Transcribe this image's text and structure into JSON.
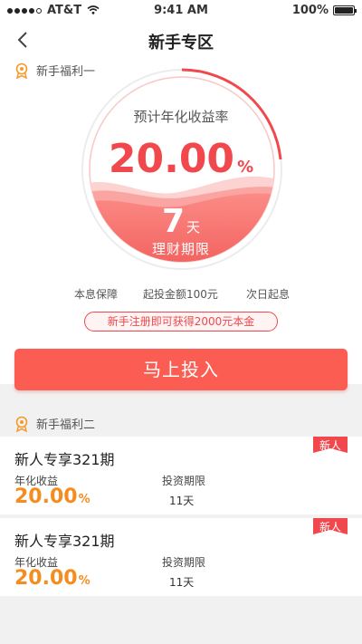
{
  "status_bar": {
    "carrier": "AT&T",
    "time": "9:41 AM",
    "battery": "100%"
  },
  "nav": {
    "title": "新手专区"
  },
  "benefit1": {
    "header": "新手福利一",
    "rate_caption": "预计年化收益率",
    "rate_value": "20.00",
    "rate_unit": "%",
    "period_value": "7",
    "period_unit": "天",
    "period_label": "理财期限",
    "features": [
      "本息保障",
      "起投金额100元",
      "次日起息"
    ],
    "promo": "新手注册即可获得2000元本金",
    "invest_button": "马上投入"
  },
  "benefit2": {
    "header": "新手福利二",
    "products": [
      {
        "title": "新人专享321期",
        "badge": "新人",
        "rate_label": "年化收益",
        "rate_value": "20.00",
        "rate_unit": "%",
        "term_label": "投资期限",
        "term_value": "11天"
      },
      {
        "title": "新人专享321期",
        "badge": "新人",
        "rate_label": "年化收益",
        "rate_value": "20.00",
        "rate_unit": "%",
        "term_label": "投资期限",
        "term_value": "11天"
      }
    ]
  },
  "colors": {
    "accent": "#f0484d",
    "button": "#fc5d53",
    "rate_orange": "#f58c1f",
    "badge": "#f0484d"
  }
}
